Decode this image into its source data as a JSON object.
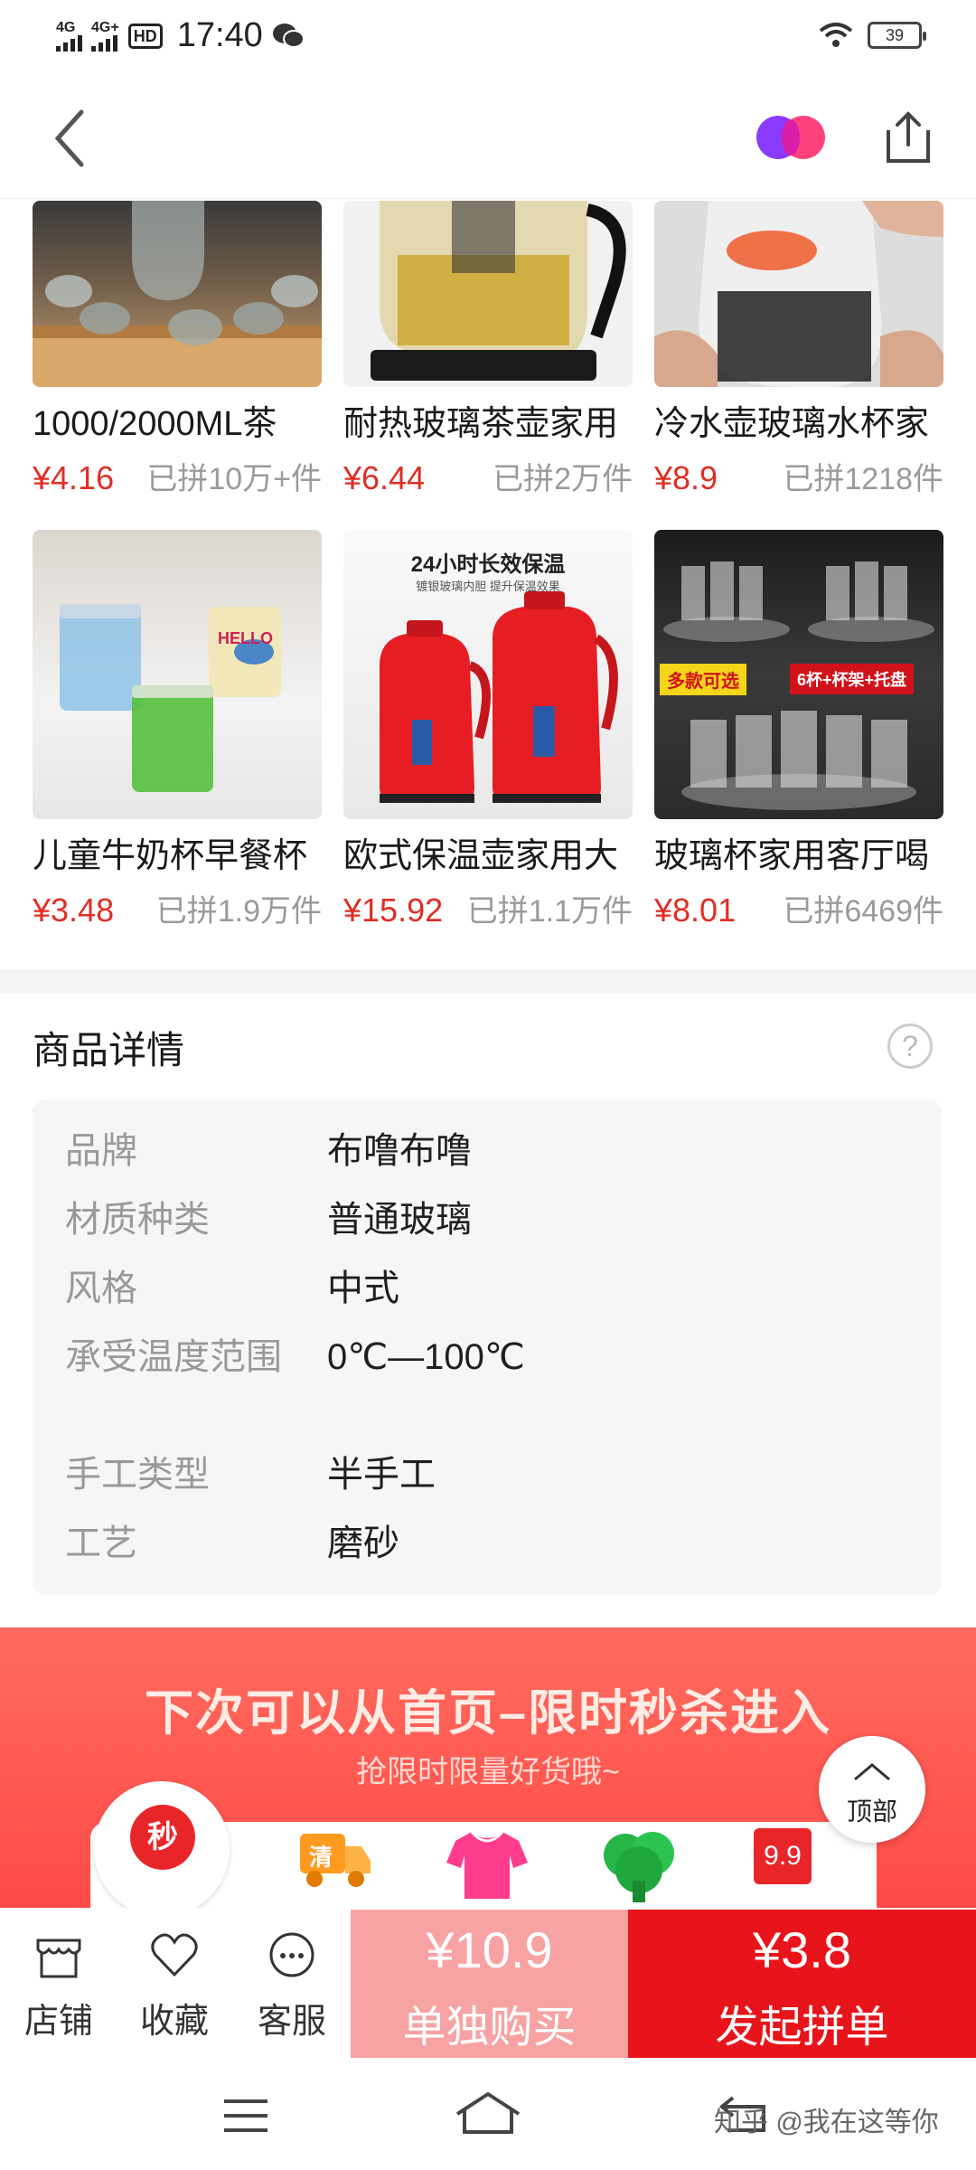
{
  "status_bar": {
    "signal1": "4G",
    "signal2": "4G+",
    "hd": "HD",
    "time": "17:40",
    "battery": "39"
  },
  "recommendations": [
    {
      "title": "1000/2000ML茶",
      "price": "¥4.16",
      "sold": "已拼10万+件"
    },
    {
      "title": "耐热玻璃茶壶家用",
      "price": "¥6.44",
      "sold": "已拼2万件"
    },
    {
      "title": "冷水壶玻璃水杯家",
      "price": "¥8.9",
      "sold": "已拼1218件"
    },
    {
      "title": "儿童牛奶杯早餐杯",
      "price": "¥3.48",
      "sold": "已拼1.9万件"
    },
    {
      "title": "欧式保温壶家用大",
      "price": "¥15.92",
      "sold": "已拼1.1万件"
    },
    {
      "title": "玻璃杯家用客厅喝",
      "price": "¥8.01",
      "sold": "已拼6469件"
    }
  ],
  "image_text": {
    "thermos_headline": "24小时长效保温",
    "thermos_sub": "镀银玻璃内胆 提升保温效果",
    "cups_tag_left": "多款可选",
    "cups_tag_right": "6杯+杯架+托盘",
    "mug_text": "HELLO"
  },
  "details": {
    "title": "商品详情",
    "help": "?",
    "specs": [
      {
        "key": "品牌",
        "value": "布噜布噜"
      },
      {
        "key": "材质种类",
        "value": "普通玻璃"
      },
      {
        "key": "风格",
        "value": "中式"
      },
      {
        "key": "承受温度范围",
        "value": "0℃—100℃"
      },
      {
        "key": "手工类型",
        "value": "半手工"
      },
      {
        "key": "工艺",
        "value": "磨砂"
      }
    ]
  },
  "promo": {
    "title": "下次可以从首页–限时秒杀进入",
    "subtitle": "抢限时限量好货哦~",
    "icons": {
      "seckill": "秒",
      "clear": "清",
      "nine": "9.9"
    }
  },
  "top_button": {
    "label": "顶部"
  },
  "action_bar": {
    "shop": "店铺",
    "favorite": "收藏",
    "service": "客服",
    "buy_alone_price": "¥10.9",
    "buy_alone_label": "单独购买",
    "group_price": "¥3.8",
    "group_label": "发起拼单"
  },
  "watermark": "知乎 @我在这等你",
  "colors": {
    "price_red": "#e02e24",
    "group_red": "#e8141b",
    "buy_pink": "#f7a3a3"
  }
}
